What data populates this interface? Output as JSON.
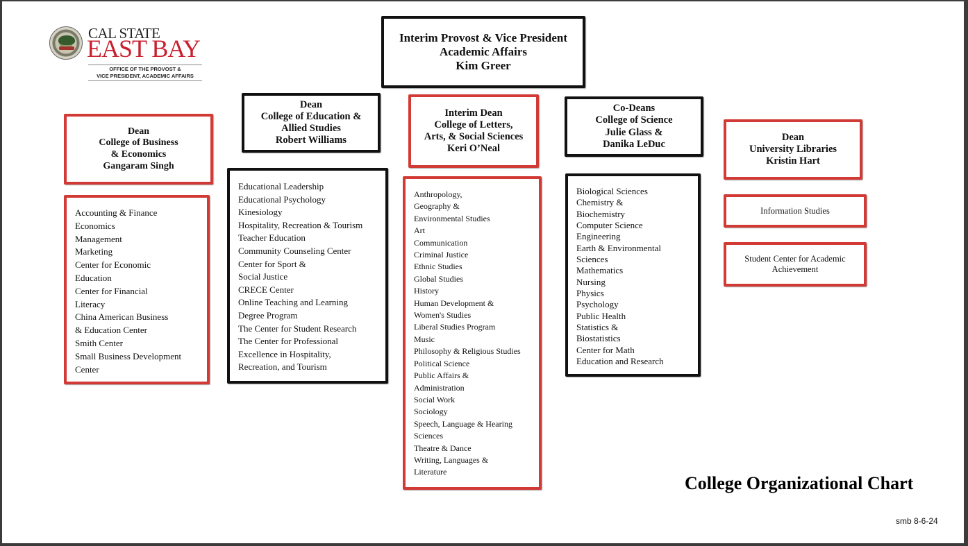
{
  "logo": {
    "line1": "CAL STATE",
    "line2": "EAST BAY",
    "office_line1": "OFFICE OF THE PROVOST &",
    "office_line2": "VICE PRESIDENT, ACADEMIC AFFAIRS",
    "seal_icon": "university-seal-icon"
  },
  "provost": {
    "lines": [
      "Interim Provost & Vice President",
      "Academic Affairs",
      "Kim Greer"
    ]
  },
  "colleges": [
    {
      "id": "business",
      "header": [
        "Dean",
        "College of Business",
        "&  Economics",
        "Gangaram Singh"
      ],
      "items": [
        "Accounting & Finance",
        "Economics",
        "Management",
        "Marketing",
        "Center for Economic",
        "Education",
        "Center for Financial",
        "Literacy",
        "China American Business",
        "& Education Center",
        "Smith Center",
        "Small Business Development",
        "Center"
      ]
    },
    {
      "id": "education",
      "header": [
        "Dean",
        "College of Education &",
        "Allied Studies",
        "Robert Williams"
      ],
      "items": [
        "Educational Leadership",
        "Educational Psychology",
        "Kinesiology",
        "Hospitality, Recreation  & Tourism",
        "Teacher Education",
        "Community Counseling  Center",
        "Center for Sport &",
        "Social Justice",
        "CRECE Center",
        "Online Teaching and Learning",
        "Degree Program",
        "The Center for Student Research",
        "The Center for Professional",
        "Excellence in Hospitality,",
        "Recreation, and Tourism"
      ]
    },
    {
      "id": "letters",
      "header": [
        "Interim Dean",
        "College of Letters,",
        "Arts, & Social Sciences",
        "Keri O’Neal"
      ],
      "items": [
        "Anthropology,",
        "Geography &",
        "Environmental Studies",
        "Art",
        "Communication",
        "Criminal Justice",
        "Ethnic Studies",
        "Global Studies",
        "History",
        "Human Development &",
        "Women's Studies",
        "Liberal Studies Program",
        "Music",
        "Philosophy & Religious  Studies",
        "Political Science",
        "Public Affairs &",
        "Administration",
        "Social Work",
        "Sociology",
        "Speech, Language &  Hearing",
        "Sciences",
        "Theatre & Dance",
        "Writing, Languages &",
        "Literature"
      ]
    },
    {
      "id": "science",
      "header": [
        "Co-Deans",
        "College of Science",
        "Julie Glass &",
        "Danika LeDuc"
      ],
      "items": [
        "Biological Sciences",
        "Chemistry &",
        "Biochemistry",
        "Computer Science",
        "Engineering",
        "Earth & Environmental",
        "Sciences",
        "Mathematics",
        "Nursing",
        "Physics",
        "Psychology",
        "Public Health",
        "Statistics &",
        "Biostatistics",
        "Center for Math",
        "Education and Research"
      ]
    },
    {
      "id": "libraries",
      "header": [
        "Dean",
        "University Libraries",
        "Kristin Hart"
      ],
      "units": [
        [
          "Information Studies"
        ],
        [
          "Student Center for  Academic",
          "Achievement"
        ]
      ]
    }
  ],
  "chart_title": "College Organizational Chart",
  "footnote": "smb 8-6-24",
  "colors": {
    "red_border": "#d23a35",
    "black_border": "#111111",
    "brand_red": "#c8202f"
  }
}
